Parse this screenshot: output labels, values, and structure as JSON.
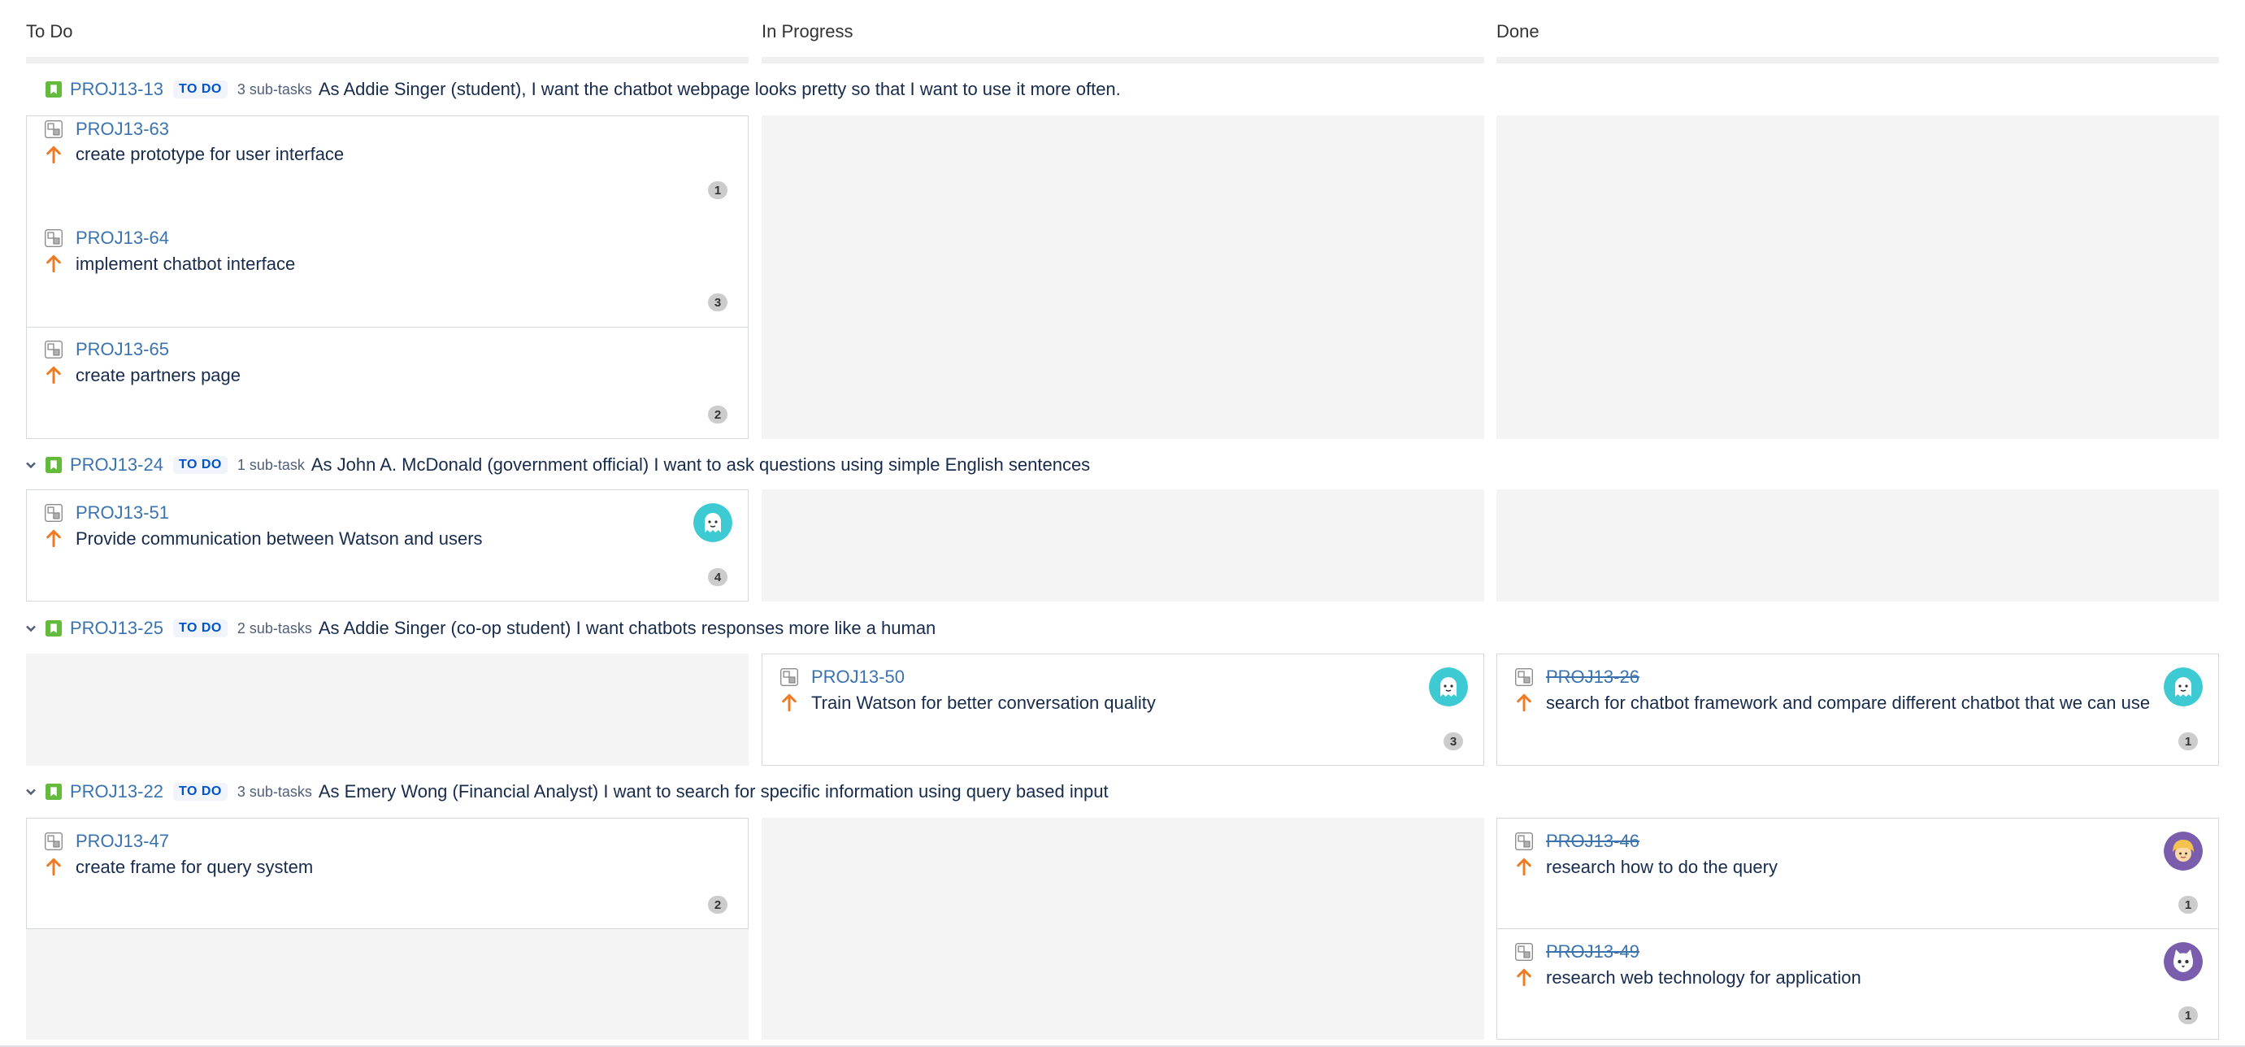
{
  "columns": [
    "To Do",
    "In Progress",
    "Done"
  ],
  "colors": {
    "link": "#3b73af",
    "story": "#63ba3c",
    "priority": "#f07a21",
    "lozenge_text": "#0052cc",
    "badge": "#cccccc",
    "avatar_teal": "#3ecad2",
    "avatar_purple": "#7b5dad"
  },
  "swimlanes": [
    {
      "key": "PROJ13-13",
      "status": "TO DO",
      "subtasks": "3 sub-tasks",
      "summary": "As Addie Singer (student), I want the chatbot webpage looks pretty so that I want to use it more often.",
      "cards": [
        {
          "key": "PROJ13-63",
          "title": "create prototype for user interface",
          "badge": "1",
          "column": "To Do",
          "icon": "subtask-icon",
          "priority_icon": "priority-up-arrow-icon"
        },
        {
          "key": "PROJ13-64",
          "title": "implement chatbot interface",
          "badge": "3",
          "column": "To Do",
          "icon": "subtask-icon",
          "priority_icon": "priority-up-arrow-icon"
        },
        {
          "key": "PROJ13-65",
          "title": "create partners page",
          "badge": "2",
          "column": "To Do",
          "icon": "subtask-icon",
          "priority_icon": "priority-up-arrow-icon"
        }
      ]
    },
    {
      "key": "PROJ13-24",
      "status": "TO DO",
      "subtasks": "1 sub-task",
      "summary": "As John A. McDonald (government official) I want to ask questions using simple English sentences",
      "cards": [
        {
          "key": "PROJ13-51",
          "title": "Provide communication between Watson and users",
          "badge": "4",
          "column": "To Do",
          "avatar": "ghost-avatar"
        }
      ]
    },
    {
      "key": "PROJ13-25",
      "status": "TO DO",
      "subtasks": "2 sub-tasks",
      "summary": "As Addie Singer (co-op student) I want chatbots responses more like a human",
      "cards": [
        {
          "key": "PROJ13-50",
          "title": "Train Watson for better conversation quality",
          "badge": "3",
          "column": "In Progress",
          "avatar": "ghost-avatar"
        },
        {
          "key": "PROJ13-26",
          "title": "search for chatbot framework and compare different chatbot that we can use",
          "badge": "1",
          "column": "Done",
          "avatar": "ghost-avatar"
        }
      ]
    },
    {
      "key": "PROJ13-22",
      "status": "TO DO",
      "subtasks": "3 sub-tasks",
      "summary": "As Emery Wong (Financial Analyst) I want to search for specific information using query based input",
      "cards": [
        {
          "key": "PROJ13-47",
          "title": "create frame for query system",
          "badge": "2",
          "column": "To Do"
        },
        {
          "key": "PROJ13-46",
          "title": "research how to do the query",
          "badge": "1",
          "column": "Done",
          "avatar": "blonde-person-avatar"
        },
        {
          "key": "PROJ13-49",
          "title": "research web technology for application",
          "badge": "1",
          "column": "Done",
          "avatar": "cat-avatar"
        }
      ]
    }
  ]
}
